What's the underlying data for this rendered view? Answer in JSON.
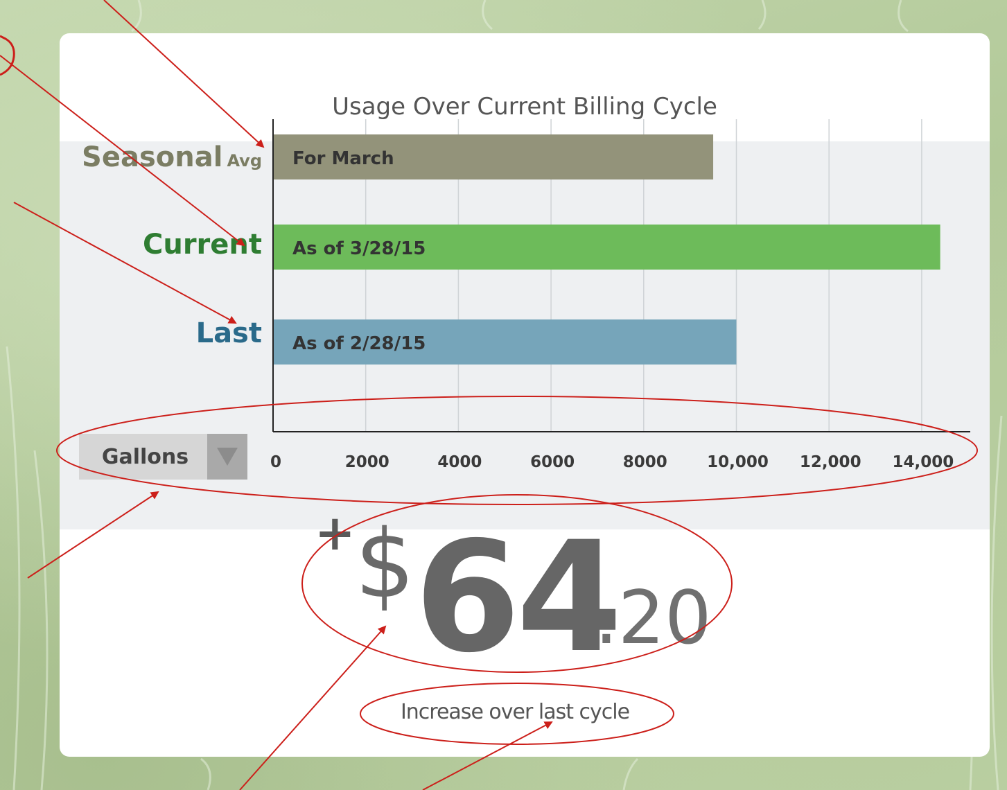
{
  "card": {
    "title": "Usage Over Current Billing Cycle"
  },
  "bars": [
    {
      "row_label": "Seasonal",
      "row_sublabel": "Avg",
      "bar_label": "For March",
      "label_color": "#7b7d63",
      "bar_color": "#93937a"
    },
    {
      "row_label": "Current",
      "row_sublabel": "",
      "bar_label": "As of 3/28/15",
      "label_color": "#2e7d32",
      "bar_color": "#6dbb5a"
    },
    {
      "row_label": "Last",
      "row_sublabel": "",
      "bar_label": "As of 2/28/15",
      "label_color": "#2a6a8a",
      "bar_color": "#76a5ba"
    }
  ],
  "chart_data": {
    "type": "bar",
    "orientation": "horizontal",
    "title": "Usage Over Current Billing Cycle",
    "categories": [
      "Seasonal Avg",
      "Current",
      "Last"
    ],
    "values": [
      9500,
      14400,
      10000
    ],
    "xlim": [
      0,
      14000
    ],
    "x_tick_labels": [
      "0",
      "2000",
      "4000",
      "6000",
      "8000",
      "10,000",
      "12,000",
      "14,000"
    ],
    "x_ticks": [
      0,
      2000,
      4000,
      6000,
      8000,
      10000,
      12000,
      14000
    ],
    "grid": true
  },
  "unit_select": {
    "value": "Gallons"
  },
  "price": {
    "sign": "+",
    "currency": "$",
    "integer": "64",
    "decimal": ".20"
  },
  "caption": "Increase over last cycle",
  "colors": {
    "annotation": "#cc1f1a",
    "axis": "#222222",
    "grid": "#cfd3d6"
  }
}
